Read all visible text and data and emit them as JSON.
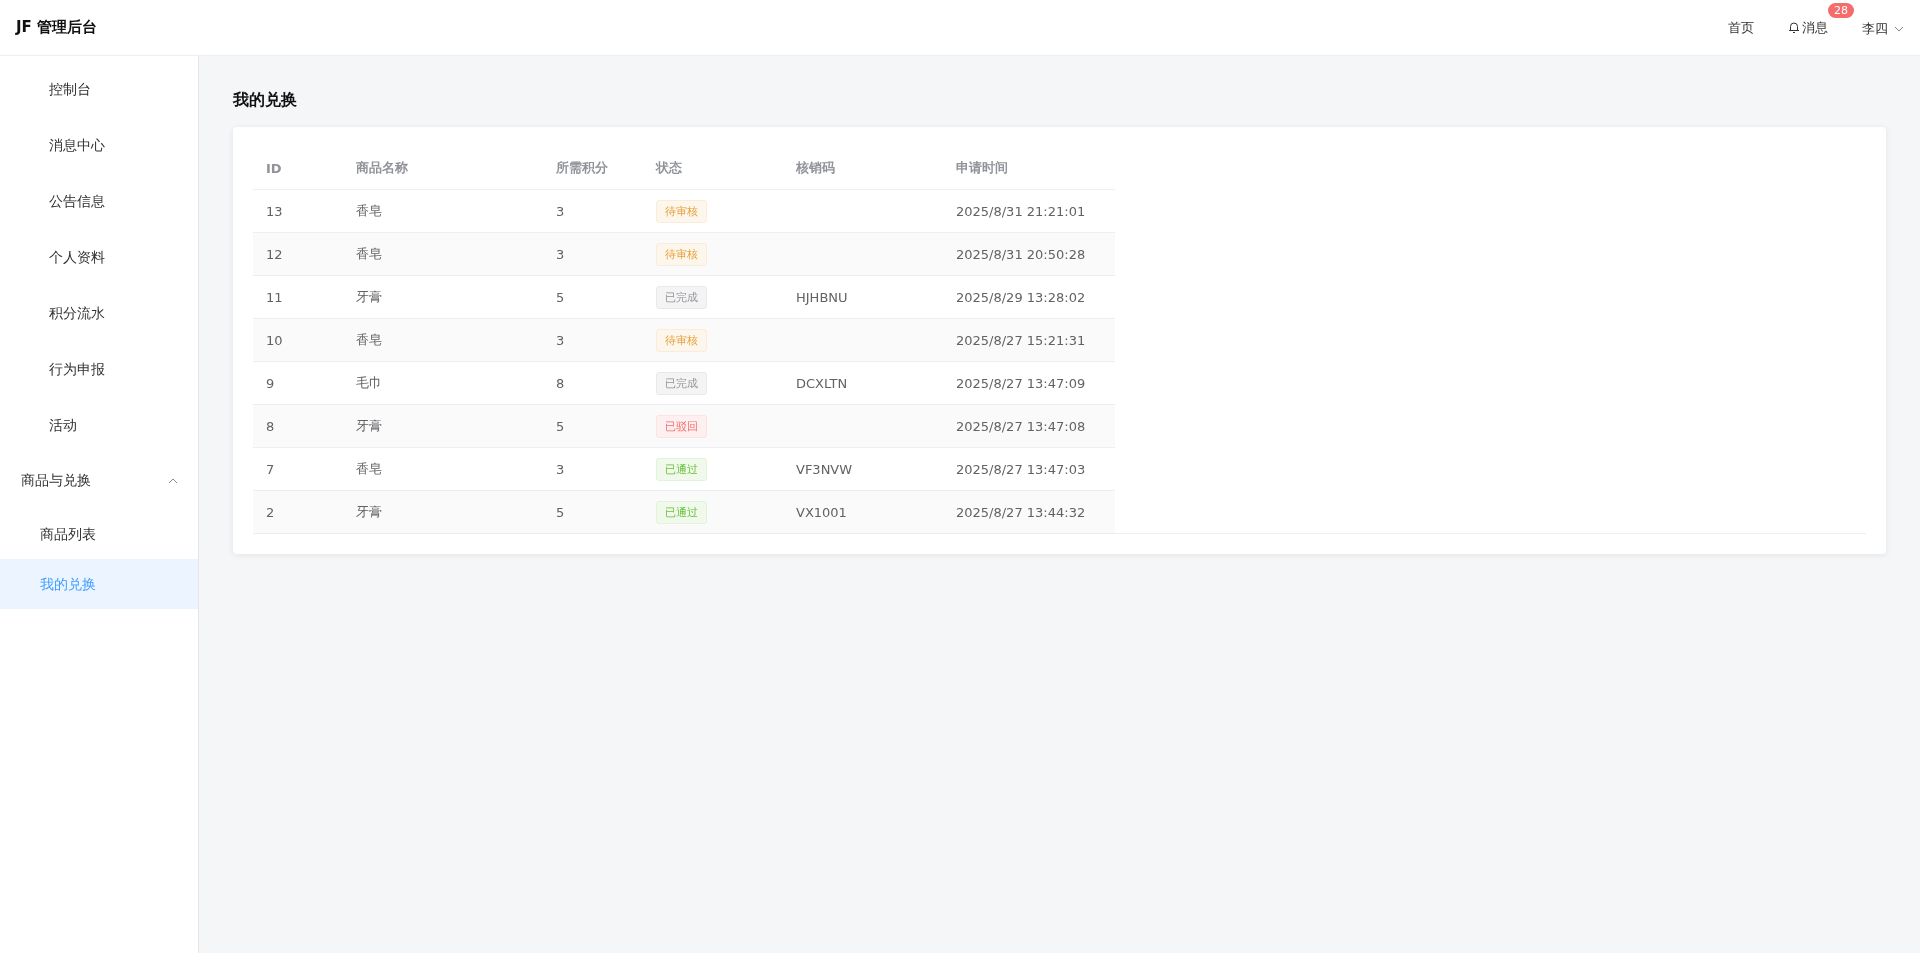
{
  "header": {
    "logo": "JF 管理后台",
    "nav": [
      {
        "label": "首页",
        "kind": "link"
      },
      {
        "label": "消息",
        "kind": "bell",
        "badge": "28"
      }
    ],
    "user": "李四"
  },
  "sidebar": {
    "items": [
      {
        "label": "控制台",
        "selected": false
      },
      {
        "label": "消息中心",
        "selected": false
      },
      {
        "label": "公告信息",
        "selected": false
      },
      {
        "label": "个人资料",
        "selected": false
      },
      {
        "label": "积分流水",
        "selected": false
      },
      {
        "label": "行为申报",
        "selected": false
      },
      {
        "label": "活动",
        "selected": false
      },
      {
        "label": "商品与兑换",
        "expanded": true,
        "children": [
          {
            "label": "商品列表",
            "selected": false
          },
          {
            "label": "我的兑换",
            "selected": true
          }
        ]
      }
    ]
  },
  "page_title": "我的兑换",
  "table": {
    "columns": [
      "ID",
      "商品名称",
      "所需积分",
      "状态",
      "核销码",
      "申请时间"
    ],
    "rows": [
      {
        "id": "13",
        "name": "香皂",
        "points": "3",
        "status": {
          "label": "待审核",
          "kind": "pending"
        },
        "code": "",
        "time": "2025/8/31 21:21:01"
      },
      {
        "id": "12",
        "name": "香皂",
        "points": "3",
        "status": {
          "label": "待审核",
          "kind": "pending"
        },
        "code": "",
        "time": "2025/8/31 20:50:28"
      },
      {
        "id": "11",
        "name": "牙膏",
        "points": "5",
        "status": {
          "label": "已完成",
          "kind": "done"
        },
        "code": "HJHBNU",
        "time": "2025/8/29 13:28:02"
      },
      {
        "id": "10",
        "name": "香皂",
        "points": "3",
        "status": {
          "label": "待审核",
          "kind": "pending"
        },
        "code": "",
        "time": "2025/8/27 15:21:31"
      },
      {
        "id": "9",
        "name": "毛巾",
        "points": "8",
        "status": {
          "label": "已完成",
          "kind": "done"
        },
        "code": "DCXLTN",
        "time": "2025/8/27 13:47:09"
      },
      {
        "id": "8",
        "name": "牙膏",
        "points": "5",
        "status": {
          "label": "已驳回",
          "kind": "rejected"
        },
        "code": "",
        "time": "2025/8/27 13:47:08"
      },
      {
        "id": "7",
        "name": "香皂",
        "points": "3",
        "status": {
          "label": "已通过",
          "kind": "approved"
        },
        "code": "VF3NVW",
        "time": "2025/8/27 13:47:03"
      },
      {
        "id": "2",
        "name": "牙膏",
        "points": "5",
        "status": {
          "label": "已通过",
          "kind": "approved"
        },
        "code": "VX1001",
        "time": "2025/8/27 13:44:32"
      }
    ]
  }
}
